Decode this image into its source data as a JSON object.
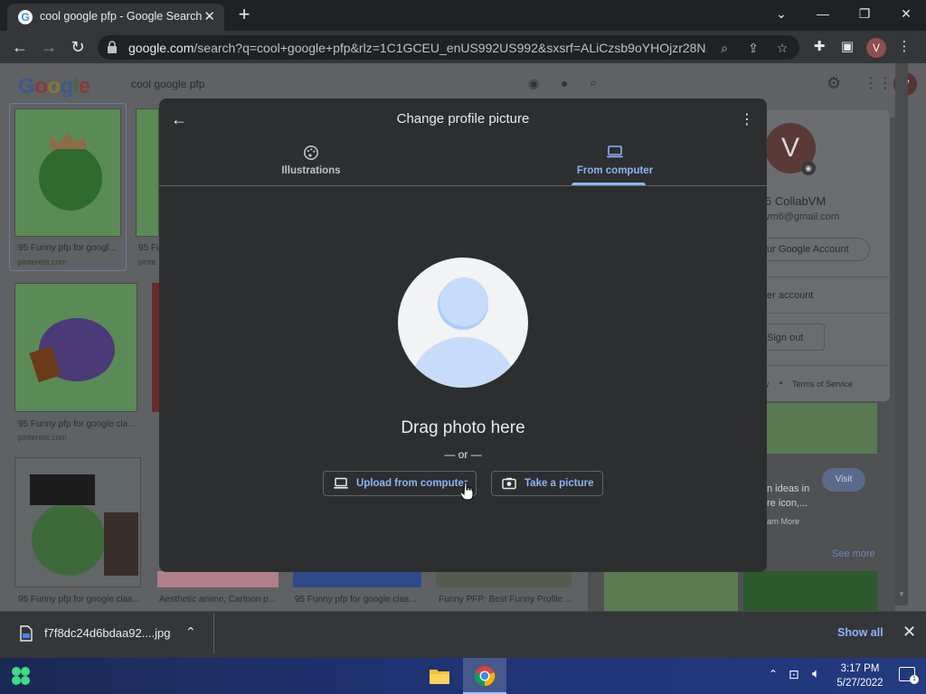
{
  "browser": {
    "tab_title": "cool google pfp - Google Search",
    "url_host": "google.com",
    "url_rest": "/search?q=cool+google+pfp&rlz=1C1GCEU_enUS992US992&sxsrf=ALiCzsb9oYHOjzr28N...",
    "profile_initial": "V"
  },
  "google": {
    "logo": "Google",
    "query": "cool google pfp",
    "results": [
      {
        "caption": "95 Funny pfp for googl...",
        "source": "pinterest.com"
      },
      {
        "caption": "95 Fu",
        "source": "pinte"
      },
      {
        "caption": "95 Funny pfp for google cla...",
        "source": "pinterest.com"
      },
      {
        "caption": "95 Funny pfp for google clas...",
        "source": ""
      },
      {
        "caption": "Aesthetic anime, Cartoon p...",
        "source": ""
      },
      {
        "caption": "95 Funny pfp for google clas...",
        "source": ""
      },
      {
        "caption": "Funny PFP: Best Funny Profile ...",
        "source": ""
      }
    ],
    "account_panel": {
      "name": "6 CollabVM",
      "email": "vm6@gmail.com",
      "manage": "ur Google Account",
      "add_account": "er account",
      "sign_out": "Sign out",
      "footer_terms": "Terms of Service",
      "footer_dot": "•",
      "footer_privacy": "y"
    },
    "side": {
      "visit": "Visit",
      "ideas": "n ideas in",
      "ideas2": "re icon,...",
      "learn": "arn More",
      "see_more": "See more"
    }
  },
  "modal": {
    "title": "Change profile picture",
    "tabs": [
      {
        "label": "Illustrations",
        "icon": "palette-icon"
      },
      {
        "label": "From computer",
        "icon": "laptop-icon",
        "selected": true
      }
    ],
    "drag_text": "Drag photo here",
    "or_text": "— or —",
    "upload_label": "Upload from computer",
    "camera_label": "Take a picture"
  },
  "download_bar": {
    "file_name": "f7f8dc24d6bdaa92....jpg",
    "show_all": "Show all"
  },
  "taskbar": {
    "time": "3:17 PM",
    "date": "5/27/2022"
  },
  "colors": {
    "accent": "#8ab4f8",
    "modal_bg": "#2d2e30",
    "chrome_dark": "#202124"
  }
}
